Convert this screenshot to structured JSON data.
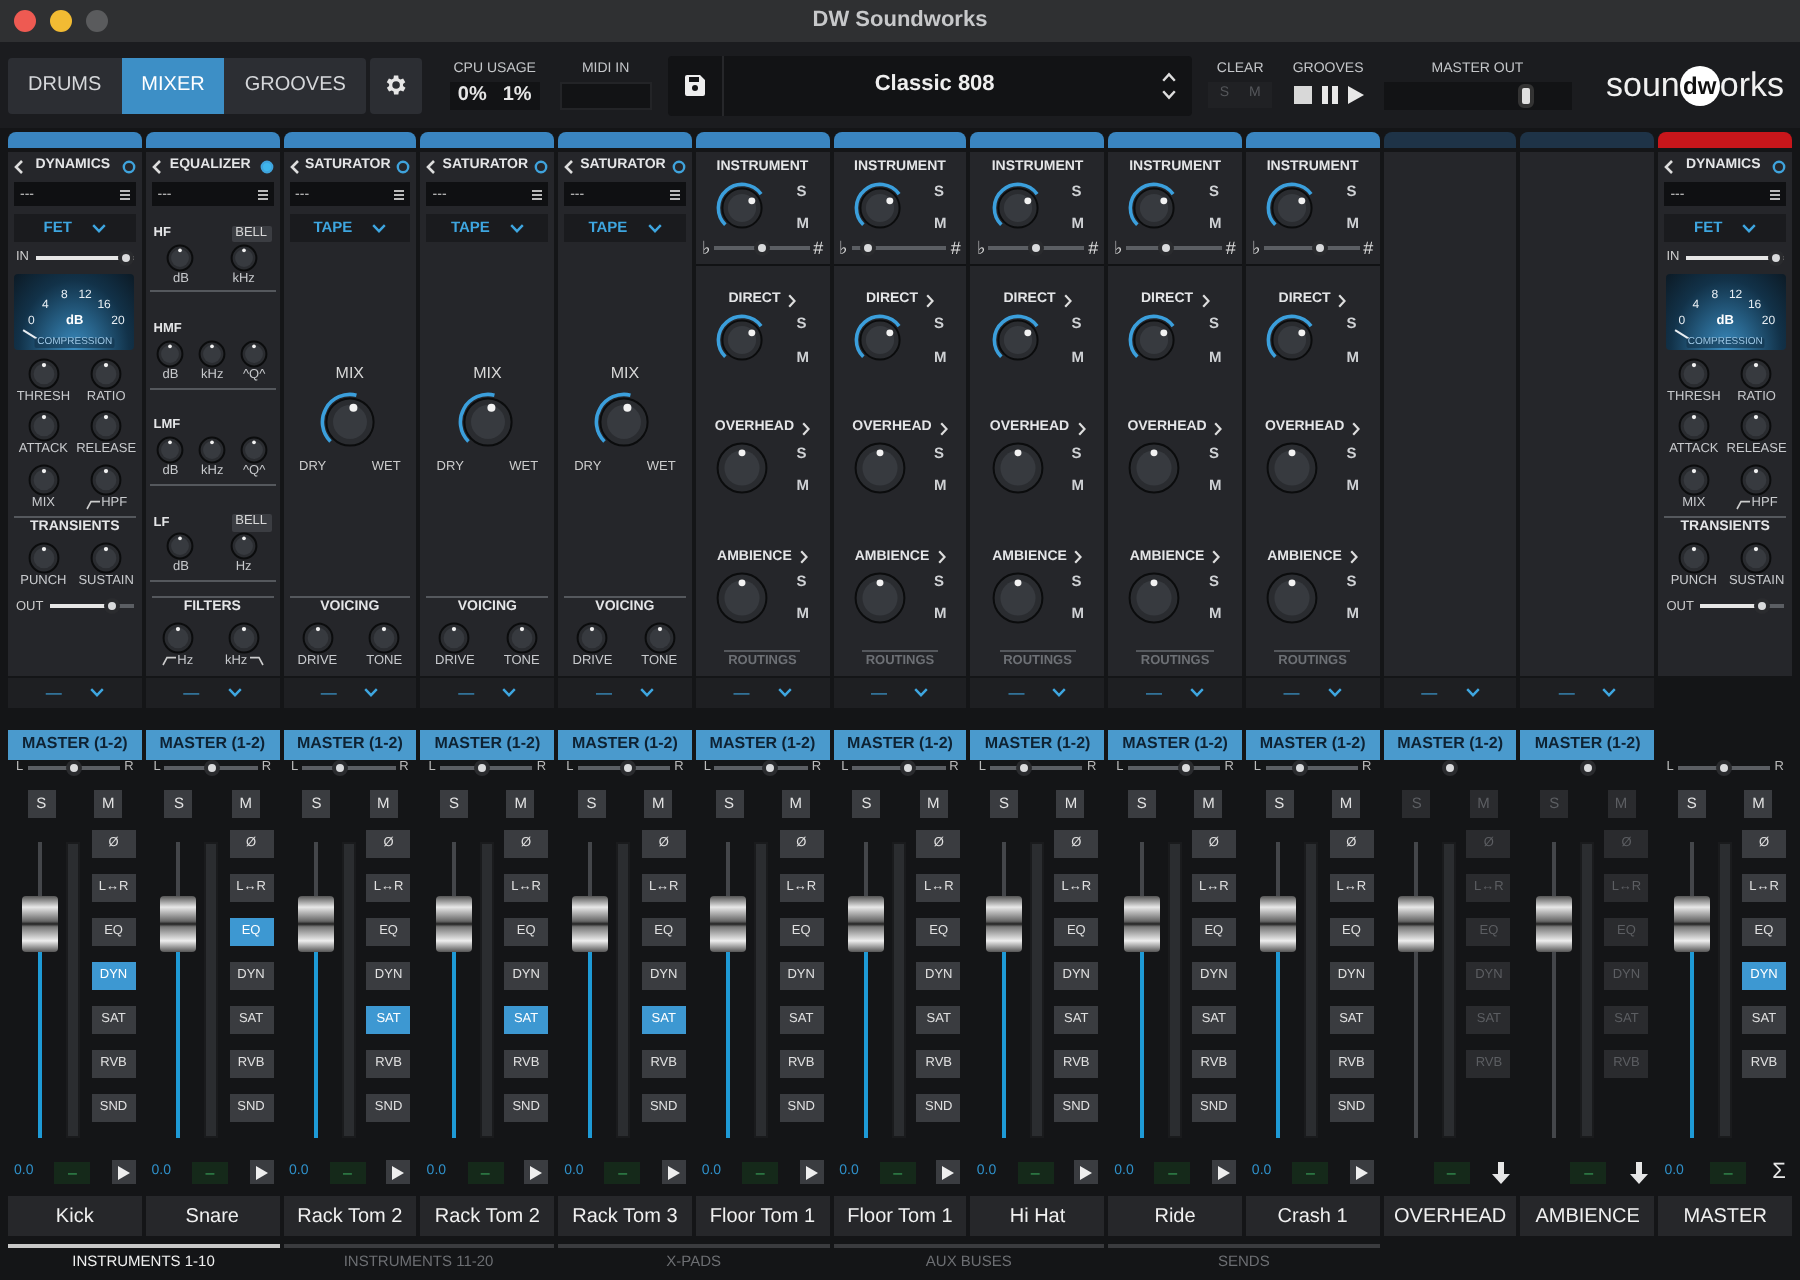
{
  "window": {
    "title": "DW Soundworks"
  },
  "toolbar": {
    "tabs": [
      {
        "label": "DRUMS",
        "selected": false
      },
      {
        "label": "MIXER",
        "selected": true
      },
      {
        "label": "GROOVES",
        "selected": false
      }
    ],
    "cpu": {
      "label": "CPU USAGE",
      "values": [
        "0%",
        "1%"
      ]
    },
    "midi_in": {
      "label": "MIDI IN"
    },
    "preset": {
      "name": "Classic 808"
    },
    "clear": {
      "label": "CLEAR",
      "buttons": [
        {
          "label": "S",
          "disabled": true
        },
        {
          "label": "M",
          "disabled": true
        }
      ]
    },
    "grooves": {
      "label": "GROOVES"
    },
    "master_out": {
      "label": "MASTER OUT",
      "level": 0.78
    },
    "logo": {
      "before": "soun",
      "mark": "dw",
      "after": "orks"
    }
  },
  "channels": [
    {
      "name": "Kick",
      "color": "#3a85c0",
      "panel": {
        "kind": "dynamics",
        "title": "DYNAMICS",
        "active": false,
        "preset": "---",
        "mode": "FET",
        "input": {
          "label": "IN",
          "level": 1
        },
        "meter": {
          "scale": [
            "0",
            "4",
            "8",
            "12",
            "16",
            "20"
          ],
          "unit": "dB",
          "caption": "COMPRESSION"
        },
        "knobs": [
          {
            "label": "THRESH",
            "kind": "plain"
          },
          {
            "label": "RATIO",
            "kind": "plain"
          },
          {
            "label": "ATTACK",
            "kind": "plain"
          },
          {
            "label": "RELEASE",
            "kind": "plain"
          },
          {
            "label": "MIX",
            "kind": "plain"
          },
          {
            "label": "HPF",
            "kind": "highpass"
          }
        ],
        "transients": {
          "title": "TRANSIENTS",
          "knobs": [
            {
              "label": "PUNCH"
            },
            {
              "label": "SUSTAIN"
            }
          ]
        },
        "output": {
          "label": "OUT",
          "level": 0.8
        }
      },
      "routing": "—",
      "output": "MASTER (1-2)",
      "pan": {
        "left": "L",
        "right": "R",
        "level": 0.5
      },
      "solo": "S",
      "mute": "M",
      "disabled": false,
      "fader": {
        "level": 0.72
      },
      "inserts": [
        {
          "label": "Ø",
          "on": false
        },
        {
          "label": "L↔R",
          "on": false
        },
        {
          "label": "EQ",
          "on": false
        },
        {
          "label": "DYN",
          "on": true
        },
        {
          "label": "SAT",
          "on": false
        },
        {
          "label": "RVB",
          "on": false
        },
        {
          "label": "SND",
          "on": false
        }
      ],
      "reading": "0.0",
      "meter": "–",
      "action": {
        "kind": "play"
      }
    },
    {
      "name": "Snare",
      "color": "#3a85c0",
      "panel": {
        "kind": "equalizer",
        "title": "EQUALIZER",
        "active": true,
        "preset": "---",
        "bands": [
          {
            "name": "HF",
            "button": "BELL",
            "knobs": [
              {
                "label": "dB"
              },
              {
                "label": "kHz"
              }
            ]
          },
          {
            "name": "HMF",
            "knobs": [
              {
                "label": "dB"
              },
              {
                "label": "kHz"
              },
              {
                "label": "^Q^"
              }
            ]
          },
          {
            "name": "LMF",
            "knobs": [
              {
                "label": "dB"
              },
              {
                "label": "kHz"
              },
              {
                "label": "^Q^"
              }
            ]
          },
          {
            "name": "LF",
            "button": "BELL",
            "knobs": [
              {
                "label": "dB"
              },
              {
                "label": "Hz"
              }
            ]
          }
        ],
        "filters": {
          "title": "FILTERS",
          "knobs": [
            {
              "label": "Hz",
              "kind": "highpass"
            },
            {
              "label": "kHz",
              "kind": "lowpass"
            }
          ]
        }
      },
      "routing": "—",
      "output": "MASTER (1-2)",
      "pan": {
        "left": "L",
        "right": "R",
        "level": 0.5
      },
      "solo": "S",
      "mute": "M",
      "disabled": false,
      "fader": {
        "level": 0.72
      },
      "inserts": [
        {
          "label": "Ø",
          "on": false
        },
        {
          "label": "L↔R",
          "on": false
        },
        {
          "label": "EQ",
          "on": true
        },
        {
          "label": "DYN",
          "on": false
        },
        {
          "label": "SAT",
          "on": false
        },
        {
          "label": "RVB",
          "on": false
        },
        {
          "label": "SND",
          "on": false
        }
      ],
      "reading": "0.0",
      "meter": "–",
      "action": {
        "kind": "play"
      }
    },
    {
      "name": "Rack Tom 2",
      "color": "#3a85c0",
      "panel": {
        "kind": "saturator",
        "title": "SATURATOR",
        "active": false,
        "preset": "---",
        "mode": "TAPE",
        "mix": {
          "label": "MIX",
          "left": "DRY",
          "right": "WET"
        },
        "voicing": {
          "title": "VOICING",
          "knobs": [
            {
              "label": "DRIVE"
            },
            {
              "label": "TONE"
            }
          ]
        }
      },
      "routing": "—",
      "output": "MASTER (1-2)",
      "pan": {
        "left": "L",
        "right": "R",
        "level": 0.38
      },
      "solo": "S",
      "mute": "M",
      "disabled": false,
      "fader": {
        "level": 0.72
      },
      "inserts": [
        {
          "label": "Ø",
          "on": false
        },
        {
          "label": "L↔R",
          "on": false
        },
        {
          "label": "EQ",
          "on": false
        },
        {
          "label": "DYN",
          "on": false
        },
        {
          "label": "SAT",
          "on": true
        },
        {
          "label": "RVB",
          "on": false
        },
        {
          "label": "SND",
          "on": false
        }
      ],
      "reading": "0.0",
      "meter": "–",
      "action": {
        "kind": "play"
      }
    },
    {
      "name": "Rack Tom 2",
      "color": "#3a85c0",
      "panel": {
        "kind": "saturator",
        "title": "SATURATOR",
        "active": false,
        "preset": "---",
        "mode": "TAPE",
        "mix": {
          "label": "MIX",
          "left": "DRY",
          "right": "WET"
        },
        "voicing": {
          "title": "VOICING",
          "knobs": [
            {
              "label": "DRIVE"
            },
            {
              "label": "TONE"
            }
          ]
        }
      },
      "routing": "—",
      "output": "MASTER (1-2)",
      "pan": {
        "left": "L",
        "right": "R",
        "level": 0.45
      },
      "solo": "S",
      "mute": "M",
      "disabled": false,
      "fader": {
        "level": 0.72
      },
      "inserts": [
        {
          "label": "Ø",
          "on": false
        },
        {
          "label": "L↔R",
          "on": false
        },
        {
          "label": "EQ",
          "on": false
        },
        {
          "label": "DYN",
          "on": false
        },
        {
          "label": "SAT",
          "on": true
        },
        {
          "label": "RVB",
          "on": false
        },
        {
          "label": "SND",
          "on": false
        }
      ],
      "reading": "0.0",
      "meter": "–",
      "action": {
        "kind": "play"
      }
    },
    {
      "name": "Rack Tom 3",
      "color": "#3a85c0",
      "panel": {
        "kind": "saturator",
        "title": "SATURATOR",
        "active": false,
        "preset": "---",
        "mode": "TAPE",
        "mix": {
          "label": "MIX",
          "left": "DRY",
          "right": "WET"
        },
        "voicing": {
          "title": "VOICING",
          "knobs": [
            {
              "label": "DRIVE"
            },
            {
              "label": "TONE"
            }
          ]
        }
      },
      "routing": "—",
      "output": "MASTER (1-2)",
      "pan": {
        "left": "L",
        "right": "R",
        "level": 0.55
      },
      "solo": "S",
      "mute": "M",
      "disabled": false,
      "fader": {
        "level": 0.72
      },
      "inserts": [
        {
          "label": "Ø",
          "on": false
        },
        {
          "label": "L↔R",
          "on": false
        },
        {
          "label": "EQ",
          "on": false
        },
        {
          "label": "DYN",
          "on": false
        },
        {
          "label": "SAT",
          "on": true
        },
        {
          "label": "RVB",
          "on": false
        },
        {
          "label": "SND",
          "on": false
        }
      ],
      "reading": "0.0",
      "meter": "–",
      "action": {
        "kind": "play"
      }
    },
    {
      "name": "Floor Tom 1",
      "color": "#3a85c0",
      "panel": {
        "kind": "instrument",
        "sends": [
          {
            "label": "INSTRUMENT",
            "arc": true,
            "arrow": false,
            "solo": "S",
            "mute": "M",
            "tune": {
              "flat": "♭",
              "sharp": "#",
              "level": 0.5
            }
          },
          {
            "label": "DIRECT",
            "arc": true,
            "arrow": true,
            "solo": "S",
            "mute": "M"
          },
          {
            "label": "OVERHEAD",
            "arc": false,
            "arrow": true,
            "solo": "S",
            "mute": "M"
          },
          {
            "label": "AMBIENCE",
            "arc": false,
            "arrow": true,
            "solo": "S",
            "mute": "M"
          }
        ],
        "routings": "ROUTINGS"
      },
      "routing": "—",
      "output": "MASTER (1-2)",
      "pan": {
        "left": "L",
        "right": "R",
        "level": 0.6
      },
      "solo": "S",
      "mute": "M",
      "disabled": false,
      "fader": {
        "level": 0.72
      },
      "inserts": [
        {
          "label": "Ø",
          "on": false
        },
        {
          "label": "L↔R",
          "on": false
        },
        {
          "label": "EQ",
          "on": false
        },
        {
          "label": "DYN",
          "on": false
        },
        {
          "label": "SAT",
          "on": false
        },
        {
          "label": "RVB",
          "on": false
        },
        {
          "label": "SND",
          "on": false
        }
      ],
      "reading": "0.0",
      "meter": "–",
      "action": {
        "kind": "play"
      }
    },
    {
      "name": "Floor Tom 1",
      "color": "#3a85c0",
      "panel": {
        "kind": "instrument",
        "sends": [
          {
            "label": "INSTRUMENT",
            "arc": true,
            "arrow": false,
            "solo": "S",
            "mute": "M",
            "tune": {
              "flat": "♭",
              "sharp": "#",
              "level": 0.1
            }
          },
          {
            "label": "DIRECT",
            "arc": true,
            "arrow": true,
            "solo": "S",
            "mute": "M"
          },
          {
            "label": "OVERHEAD",
            "arc": false,
            "arrow": true,
            "solo": "S",
            "mute": "M"
          },
          {
            "label": "AMBIENCE",
            "arc": false,
            "arrow": true,
            "solo": "S",
            "mute": "M"
          }
        ],
        "routings": "ROUTINGS"
      },
      "routing": "—",
      "output": "MASTER (1-2)",
      "pan": {
        "left": "L",
        "right": "R",
        "level": 0.62
      },
      "solo": "S",
      "mute": "M",
      "disabled": false,
      "fader": {
        "level": 0.72
      },
      "inserts": [
        {
          "label": "Ø",
          "on": false
        },
        {
          "label": "L↔R",
          "on": false
        },
        {
          "label": "EQ",
          "on": false
        },
        {
          "label": "DYN",
          "on": false
        },
        {
          "label": "SAT",
          "on": false
        },
        {
          "label": "RVB",
          "on": false
        },
        {
          "label": "SND",
          "on": false
        }
      ],
      "reading": "0.0",
      "meter": "–",
      "action": {
        "kind": "play"
      }
    },
    {
      "name": "Hi Hat",
      "color": "#3a85c0",
      "panel": {
        "kind": "instrument",
        "sends": [
          {
            "label": "INSTRUMENT",
            "arc": true,
            "arrow": false,
            "solo": "S",
            "mute": "M",
            "tune": {
              "flat": "♭",
              "sharp": "#",
              "level": 0.5
            }
          },
          {
            "label": "DIRECT",
            "arc": true,
            "arrow": true,
            "solo": "S",
            "mute": "M"
          },
          {
            "label": "OVERHEAD",
            "arc": false,
            "arrow": true,
            "solo": "S",
            "mute": "M"
          },
          {
            "label": "AMBIENCE",
            "arc": false,
            "arrow": true,
            "solo": "S",
            "mute": "M"
          }
        ],
        "routings": "ROUTINGS"
      },
      "routing": "—",
      "output": "MASTER (1-2)",
      "pan": {
        "left": "L",
        "right": "R",
        "level": 0.35
      },
      "solo": "S",
      "mute": "M",
      "disabled": false,
      "fader": {
        "level": 0.72
      },
      "inserts": [
        {
          "label": "Ø",
          "on": false
        },
        {
          "label": "L↔R",
          "on": false
        },
        {
          "label": "EQ",
          "on": false
        },
        {
          "label": "DYN",
          "on": false
        },
        {
          "label": "SAT",
          "on": false
        },
        {
          "label": "RVB",
          "on": false
        },
        {
          "label": "SND",
          "on": false
        }
      ],
      "reading": "0.0",
      "meter": "–",
      "action": {
        "kind": "play"
      }
    },
    {
      "name": "Ride",
      "color": "#3a85c0",
      "panel": {
        "kind": "instrument",
        "sends": [
          {
            "label": "INSTRUMENT",
            "arc": true,
            "arrow": false,
            "solo": "S",
            "mute": "M",
            "tune": {
              "flat": "♭",
              "sharp": "#",
              "level": 0.4
            }
          },
          {
            "label": "DIRECT",
            "arc": true,
            "arrow": true,
            "solo": "S",
            "mute": "M"
          },
          {
            "label": "OVERHEAD",
            "arc": false,
            "arrow": true,
            "solo": "S",
            "mute": "M"
          },
          {
            "label": "AMBIENCE",
            "arc": false,
            "arrow": true,
            "solo": "S",
            "mute": "M"
          }
        ],
        "routings": "ROUTINGS"
      },
      "routing": "—",
      "output": "MASTER (1-2)",
      "pan": {
        "left": "L",
        "right": "R",
        "level": 0.65
      },
      "solo": "S",
      "mute": "M",
      "disabled": false,
      "fader": {
        "level": 0.72
      },
      "inserts": [
        {
          "label": "Ø",
          "on": false
        },
        {
          "label": "L↔R",
          "on": false
        },
        {
          "label": "EQ",
          "on": false
        },
        {
          "label": "DYN",
          "on": false
        },
        {
          "label": "SAT",
          "on": false
        },
        {
          "label": "RVB",
          "on": false
        },
        {
          "label": "SND",
          "on": false
        }
      ],
      "reading": "0.0",
      "meter": "–",
      "action": {
        "kind": "play"
      }
    },
    {
      "name": "Crash 1",
      "color": "#3a85c0",
      "panel": {
        "kind": "instrument",
        "sends": [
          {
            "label": "INSTRUMENT",
            "arc": true,
            "arrow": false,
            "solo": "S",
            "mute": "M",
            "tune": {
              "flat": "♭",
              "sharp": "#",
              "level": 0.6
            }
          },
          {
            "label": "DIRECT",
            "arc": true,
            "arrow": true,
            "solo": "S",
            "mute": "M"
          },
          {
            "label": "OVERHEAD",
            "arc": false,
            "arrow": true,
            "solo": "S",
            "mute": "M"
          },
          {
            "label": "AMBIENCE",
            "arc": false,
            "arrow": true,
            "solo": "S",
            "mute": "M"
          }
        ],
        "routings": "ROUTINGS"
      },
      "routing": "—",
      "output": "MASTER (1-2)",
      "pan": {
        "left": "L",
        "right": "R",
        "level": 0.35
      },
      "solo": "S",
      "mute": "M",
      "disabled": false,
      "fader": {
        "level": 0.72
      },
      "inserts": [
        {
          "label": "Ø",
          "on": false
        },
        {
          "label": "L↔R",
          "on": false
        },
        {
          "label": "EQ",
          "on": false
        },
        {
          "label": "DYN",
          "on": false
        },
        {
          "label": "SAT",
          "on": false
        },
        {
          "label": "RVB",
          "on": false
        },
        {
          "label": "SND",
          "on": false
        }
      ],
      "reading": "0.0",
      "meter": "–",
      "action": {
        "kind": "play"
      }
    },
    {
      "name": "OVERHEAD",
      "color": "#1e3347",
      "panel": {
        "kind": "empty"
      },
      "routing": "—",
      "output": "MASTER (1-2)",
      "pan": {
        "level": 0.5
      },
      "solo": "S",
      "mute": "M",
      "disabled": true,
      "fader": {
        "level": 0.72
      },
      "inserts": [
        {
          "label": "Ø",
          "on": false
        },
        {
          "label": "L↔R",
          "on": false
        },
        {
          "label": "EQ",
          "on": false
        },
        {
          "label": "DYN",
          "on": false
        },
        {
          "label": "SAT",
          "on": false
        },
        {
          "label": "RVB",
          "on": false
        }
      ],
      "meter": "–",
      "action": {
        "kind": "down"
      }
    },
    {
      "name": "AMBIENCE",
      "color": "#1e3347",
      "panel": {
        "kind": "empty"
      },
      "routing": "—",
      "output": "MASTER (1-2)",
      "pan": {
        "level": 0.5
      },
      "solo": "S",
      "mute": "M",
      "disabled": true,
      "fader": {
        "level": 0.72
      },
      "inserts": [
        {
          "label": "Ø",
          "on": false
        },
        {
          "label": "L↔R",
          "on": false
        },
        {
          "label": "EQ",
          "on": false
        },
        {
          "label": "DYN",
          "on": false
        },
        {
          "label": "SAT",
          "on": false
        },
        {
          "label": "RVB",
          "on": false
        }
      ],
      "meter": "–",
      "action": {
        "kind": "down"
      }
    },
    {
      "name": "MASTER",
      "color": "#c8161b",
      "panel": {
        "kind": "dynamics",
        "title": "DYNAMICS",
        "active": false,
        "preset": "---",
        "mode": "FET",
        "input": {
          "label": "IN",
          "level": 1
        },
        "meter": {
          "scale": [
            "0",
            "4",
            "8",
            "12",
            "16",
            "20"
          ],
          "unit": "dB",
          "caption": "COMPRESSION"
        },
        "knobs": [
          {
            "label": "THRESH",
            "kind": "plain"
          },
          {
            "label": "RATIO",
            "kind": "plain"
          },
          {
            "label": "ATTACK",
            "kind": "plain"
          },
          {
            "label": "RELEASE",
            "kind": "plain"
          },
          {
            "label": "MIX",
            "kind": "plain"
          },
          {
            "label": "HPF",
            "kind": "highpass"
          }
        ],
        "transients": {
          "title": "TRANSIENTS",
          "knobs": [
            {
              "label": "PUNCH"
            },
            {
              "label": "SUSTAIN"
            }
          ]
        },
        "output": {
          "label": "OUT",
          "level": 0.8
        }
      },
      "pan": {
        "left": "L",
        "right": "R",
        "level": 0.5
      },
      "solo": "S",
      "mute": "M",
      "disabled": false,
      "fader": {
        "level": 0.72
      },
      "inserts": [
        {
          "label": "Ø",
          "on": false
        },
        {
          "label": "L↔R",
          "on": false
        },
        {
          "label": "EQ",
          "on": false
        },
        {
          "label": "DYN",
          "on": true
        },
        {
          "label": "SAT",
          "on": false
        },
        {
          "label": "RVB",
          "on": false
        }
      ],
      "reading": "0.0",
      "meter": "–",
      "action": {
        "kind": "sum",
        "label": "Σ"
      }
    }
  ],
  "sections": [
    {
      "label": "INSTRUMENTS 1-10",
      "selected": true
    },
    {
      "label": "INSTRUMENTS 11-20",
      "selected": false
    },
    {
      "label": "X-PADS",
      "selected": false
    },
    {
      "label": "AUX BUSES",
      "selected": false
    },
    {
      "label": "SENDS",
      "selected": false
    }
  ]
}
